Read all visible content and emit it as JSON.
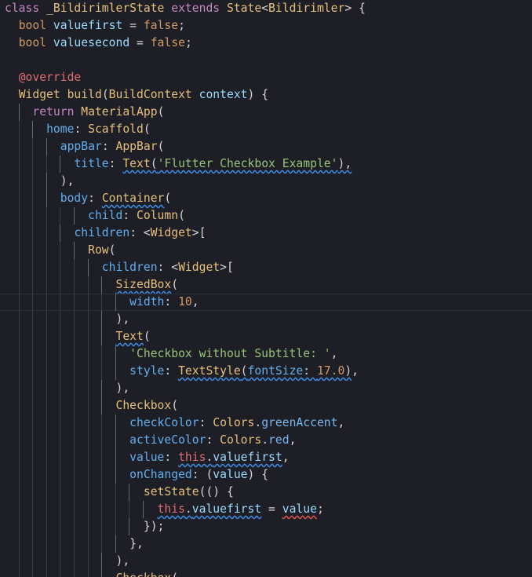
{
  "editor": {
    "language": "Dart",
    "lines": [
      {
        "indent": 0,
        "tokens": [
          [
            "kw",
            "class "
          ],
          [
            "class",
            "_BildirimlerState "
          ],
          [
            "kw",
            "extends "
          ],
          [
            "class",
            "State"
          ],
          [
            "punc",
            "<"
          ],
          [
            "class",
            "Bildirimler"
          ],
          [
            "punc",
            "> {"
          ]
        ]
      },
      {
        "indent": 1,
        "tokens": [
          [
            "kw2",
            "bool "
          ],
          [
            "var",
            "valuefirst"
          ],
          [
            "punc",
            " = "
          ],
          [
            "kw2",
            "false"
          ],
          [
            "punc",
            ";"
          ]
        ]
      },
      {
        "indent": 1,
        "tokens": [
          [
            "kw2",
            "bool "
          ],
          [
            "var",
            "valuesecond"
          ],
          [
            "punc",
            " = "
          ],
          [
            "kw2",
            "false"
          ],
          [
            "punc",
            ";"
          ]
        ]
      },
      {
        "indent": 0,
        "tokens": []
      },
      {
        "indent": 1,
        "tokens": [
          [
            "anno",
            "@override"
          ]
        ]
      },
      {
        "indent": 1,
        "tokens": [
          [
            "class",
            "Widget "
          ],
          [
            "func",
            "build"
          ],
          [
            "punc",
            "("
          ],
          [
            "class",
            "BuildContext "
          ],
          [
            "var",
            "context"
          ],
          [
            "punc",
            ") {"
          ]
        ]
      },
      {
        "indent": 2,
        "tokens": [
          [
            "kw",
            "return "
          ],
          [
            "class",
            "MaterialApp"
          ],
          [
            "punc",
            "("
          ]
        ]
      },
      {
        "indent": 3,
        "tokens": [
          [
            "named",
            "home"
          ],
          [
            "punc",
            ": "
          ],
          [
            "class",
            "Scaffold"
          ],
          [
            "punc",
            "("
          ]
        ]
      },
      {
        "indent": 4,
        "tokens": [
          [
            "named",
            "appBar"
          ],
          [
            "punc",
            ": "
          ],
          [
            "class",
            "AppBar"
          ],
          [
            "punc",
            "("
          ]
        ]
      },
      {
        "indent": 5,
        "tokens": [
          [
            "named",
            "title"
          ],
          [
            "punc",
            ": "
          ],
          [
            "class",
            "Text",
            "sqb"
          ],
          [
            "punc",
            "(",
            "sqb"
          ],
          [
            "str",
            "'Flutter Checkbox Example'",
            "sqb"
          ],
          [
            "punc",
            "),",
            "sqb"
          ]
        ]
      },
      {
        "indent": 4,
        "tokens": [
          [
            "punc",
            "),"
          ]
        ]
      },
      {
        "indent": 4,
        "tokens": [
          [
            "named",
            "body"
          ],
          [
            "punc",
            ": "
          ],
          [
            "class",
            "Container",
            "sqb"
          ],
          [
            "punc",
            "("
          ]
        ]
      },
      {
        "indent": 6,
        "tokens": [
          [
            "named",
            "child"
          ],
          [
            "punc",
            ": "
          ],
          [
            "class",
            "Column"
          ],
          [
            "punc",
            "("
          ]
        ]
      },
      {
        "indent": 5,
        "tokens": [
          [
            "named",
            "children"
          ],
          [
            "punc",
            ": <"
          ],
          [
            "class",
            "Widget"
          ],
          [
            "punc",
            ">["
          ]
        ]
      },
      {
        "indent": 6,
        "tokens": [
          [
            "class",
            "Row"
          ],
          [
            "punc",
            "("
          ]
        ]
      },
      {
        "indent": 7,
        "tokens": [
          [
            "named",
            "children"
          ],
          [
            "punc",
            ": <"
          ],
          [
            "class",
            "Widget"
          ],
          [
            "punc",
            ">["
          ]
        ]
      },
      {
        "indent": 8,
        "tokens": [
          [
            "class",
            "SizedBox",
            "sqb"
          ],
          [
            "punc",
            "("
          ]
        ]
      },
      {
        "indent": 9,
        "cursor": true,
        "tokens": [
          [
            "named",
            "width"
          ],
          [
            "punc",
            ": "
          ],
          [
            "num",
            "10"
          ],
          [
            "punc",
            ","
          ]
        ]
      },
      {
        "indent": 8,
        "tokens": [
          [
            "punc",
            "),"
          ]
        ]
      },
      {
        "indent": 8,
        "tokens": [
          [
            "class",
            "Text",
            "sqb"
          ],
          [
            "punc",
            "("
          ]
        ]
      },
      {
        "indent": 9,
        "tokens": [
          [
            "str",
            "'Checkbox without Subtitle: '"
          ],
          [
            "punc",
            ","
          ]
        ]
      },
      {
        "indent": 9,
        "tokens": [
          [
            "named",
            "style"
          ],
          [
            "punc",
            ": "
          ],
          [
            "class",
            "TextStyle",
            "sqb"
          ],
          [
            "punc",
            "(",
            "sqb"
          ],
          [
            "named",
            "fontSize",
            "sqb"
          ],
          [
            "punc",
            ": ",
            "sqb"
          ],
          [
            "num",
            "17.0",
            "sqb"
          ],
          [
            "punc",
            ")",
            "sqb"
          ],
          [
            "punc",
            ","
          ]
        ]
      },
      {
        "indent": 8,
        "tokens": [
          [
            "punc",
            "),"
          ]
        ]
      },
      {
        "indent": 8,
        "tokens": [
          [
            "class",
            "Checkbox"
          ],
          [
            "punc",
            "("
          ]
        ]
      },
      {
        "indent": 9,
        "tokens": [
          [
            "named",
            "checkColor"
          ],
          [
            "punc",
            ": "
          ],
          [
            "class",
            "Colors"
          ],
          [
            "punc",
            "."
          ],
          [
            "prop",
            "greenAccent"
          ],
          [
            "punc",
            ","
          ]
        ]
      },
      {
        "indent": 9,
        "tokens": [
          [
            "named",
            "activeColor"
          ],
          [
            "punc",
            ": "
          ],
          [
            "class",
            "Colors"
          ],
          [
            "punc",
            "."
          ],
          [
            "prop",
            "red"
          ],
          [
            "punc",
            ","
          ]
        ]
      },
      {
        "indent": 9,
        "tokens": [
          [
            "named",
            "value"
          ],
          [
            "punc",
            ": "
          ],
          [
            "this",
            "this",
            "sqb"
          ],
          [
            "punc",
            ".",
            "sqb"
          ],
          [
            "var",
            "valuefirst",
            "sqb"
          ],
          [
            "punc",
            ","
          ]
        ]
      },
      {
        "indent": 9,
        "tokens": [
          [
            "named",
            "onChanged"
          ],
          [
            "punc",
            ": ("
          ],
          [
            "var",
            "value"
          ],
          [
            "punc",
            ") {"
          ]
        ]
      },
      {
        "indent": 10,
        "tokens": [
          [
            "func",
            "setState"
          ],
          [
            "punc",
            "(() {"
          ]
        ]
      },
      {
        "indent": 11,
        "tokens": [
          [
            "this",
            "this",
            "sqb"
          ],
          [
            "punc",
            ".",
            "sqb"
          ],
          [
            "var",
            "valuefirst",
            "sqb"
          ],
          [
            "punc",
            " = "
          ],
          [
            "var",
            "value",
            "sqr"
          ],
          [
            "punc",
            ";"
          ]
        ]
      },
      {
        "indent": 10,
        "tokens": [
          [
            "punc",
            "});"
          ]
        ]
      },
      {
        "indent": 9,
        "tokens": [
          [
            "punc",
            "},"
          ]
        ]
      },
      {
        "indent": 8,
        "tokens": [
          [
            "punc",
            "),"
          ]
        ]
      },
      {
        "indent": 8,
        "tokens": [
          [
            "class",
            "Checkbox"
          ],
          [
            "punc",
            "("
          ]
        ]
      }
    ]
  }
}
